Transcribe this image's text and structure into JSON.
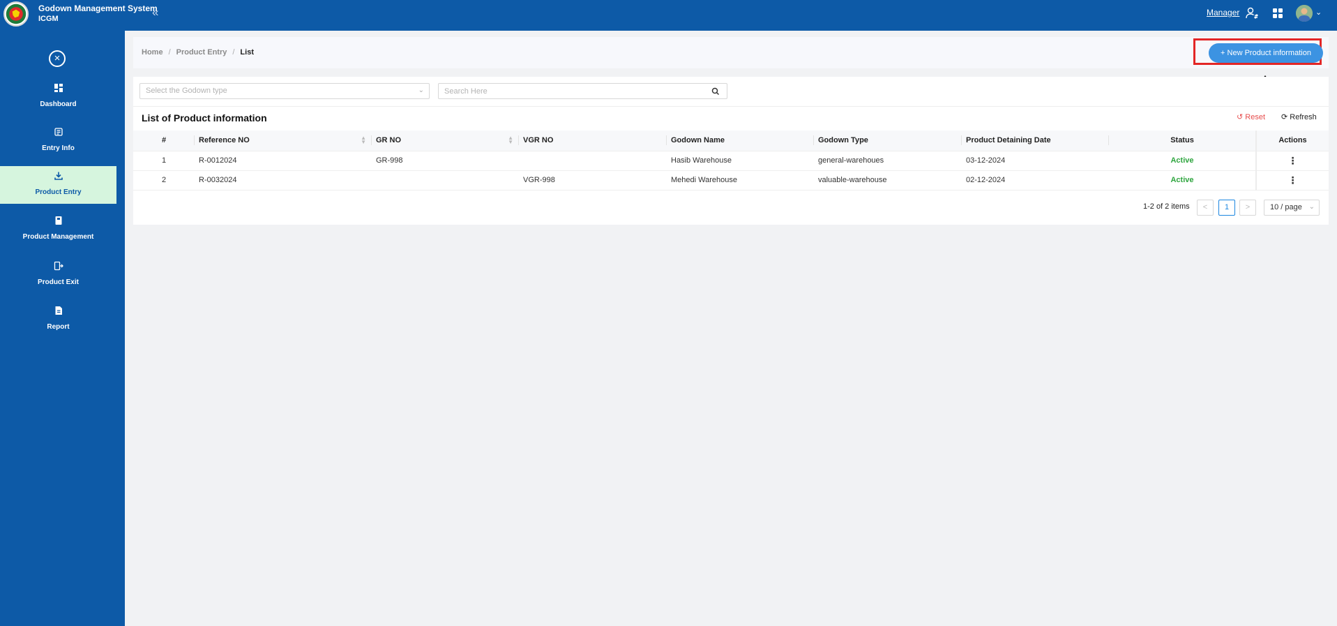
{
  "header": {
    "title": "Godown Management System",
    "subtitle": "ICGM",
    "collapse_icon": "«",
    "role": "Manager"
  },
  "sidebar": {
    "items": [
      {
        "label": "Dashboard",
        "icon": "dashboard-icon"
      },
      {
        "label": "Entry Info",
        "icon": "entry-info-icon"
      },
      {
        "label": "Product Entry",
        "icon": "download-icon",
        "active": true
      },
      {
        "label": "Product Management",
        "icon": "book-icon"
      },
      {
        "label": "Product Exit",
        "icon": "exit-icon"
      },
      {
        "label": "Report",
        "icon": "report-icon"
      }
    ]
  },
  "breadcrumb": {
    "home": "Home",
    "section": "Product Entry",
    "current": "List",
    "separator": "/"
  },
  "actions": {
    "new_button": "+ New Product information"
  },
  "filters": {
    "godown_type_placeholder": "Select the Godown type",
    "search_placeholder": "Search Here"
  },
  "list": {
    "title": "List of Product information",
    "reset_label": "Reset",
    "refresh_label": "Refresh",
    "columns": [
      "#",
      "Reference NO",
      "GR NO",
      "VGR NO",
      "Godown Name",
      "Godown Type",
      "Product Detaining Date",
      "Status",
      "Actions"
    ],
    "rows": [
      {
        "index": "1",
        "reference": "R-0012024",
        "gr": "GR-998",
        "vgr": "",
        "godown_name": "Hasib Warehouse",
        "godown_type": "general-warehoues",
        "date": "03-12-2024",
        "status": "Active",
        "action": "⋮"
      },
      {
        "index": "2",
        "reference": "R-0032024",
        "gr": "",
        "vgr": "VGR-998",
        "godown_name": "Mehedi Warehouse",
        "godown_type": "valuable-warehouse",
        "date": "02-12-2024",
        "status": "Active",
        "action": "⋮"
      }
    ]
  },
  "pagination": {
    "info": "1-2 of 2 items",
    "prev": "<",
    "current_page": "1",
    "next": ">",
    "page_size": "10 / page"
  },
  "colors": {
    "primary": "#0d5aa7",
    "accent_button": "#3c93e2",
    "active_nav_bg": "#d6f5de",
    "status_active": "#2fa53f",
    "reset": "#e74c4c",
    "highlight_frame": "#e32626"
  }
}
